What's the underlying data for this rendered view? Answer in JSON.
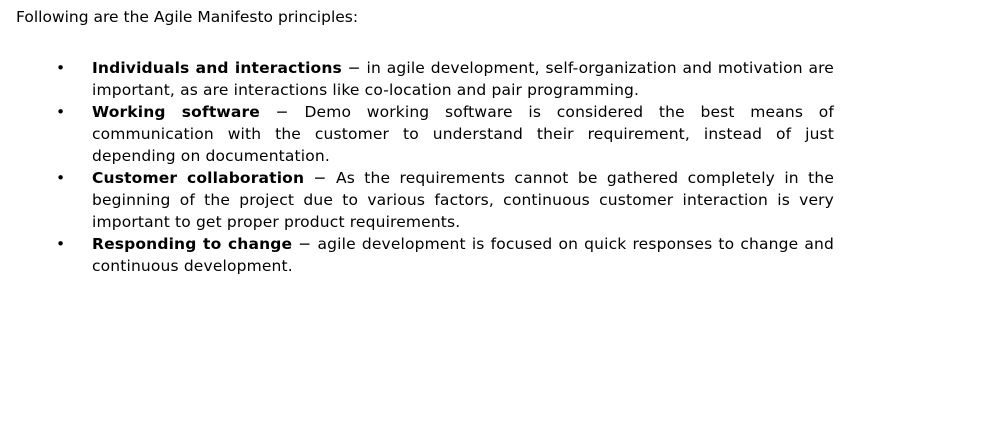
{
  "intro": "Following are the Agile Manifesto principles:",
  "bullet_symbol": "•",
  "principles": [
    {
      "term": "Individuals and interactions",
      "description": " − in agile development, self-organization and motivation are important, as are interactions like co-location and pair programming."
    },
    {
      "term": "Working software",
      "description": " − Demo working software is considered the best means of communication with the customer to understand their requirement, instead of just depending on documentation."
    },
    {
      "term": "Customer collaboration",
      "description": " − As the requirements cannot be gathered completely in the beginning of the project due to various factors, continuous customer interaction is very important to get proper product requirements."
    },
    {
      "term": "Responding to change",
      "description": " − agile development is focused on quick responses to change and continuous development."
    }
  ]
}
